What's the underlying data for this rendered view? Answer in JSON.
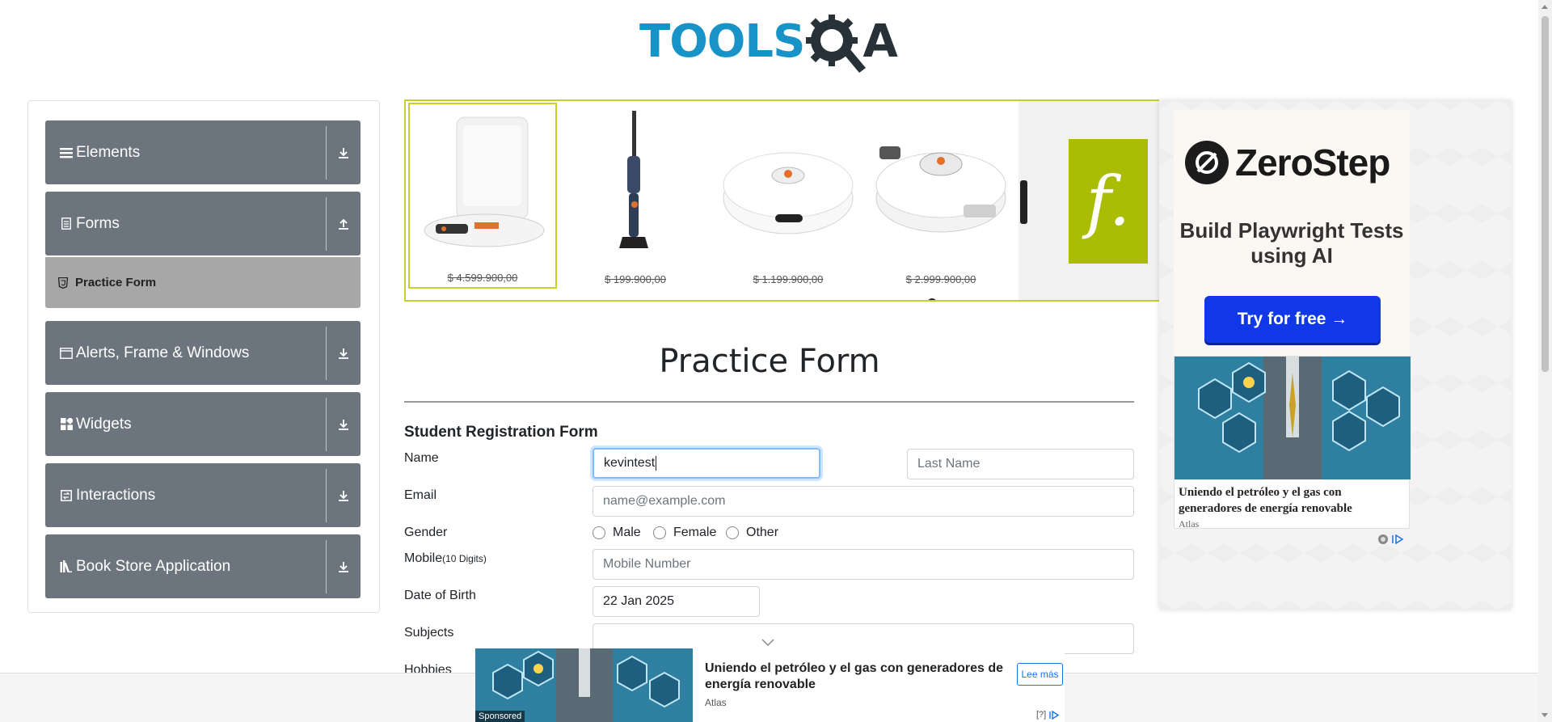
{
  "header": {
    "logo_text": "TOOLS",
    "logo_suffix": "A"
  },
  "sidebar": {
    "groups": [
      {
        "label": "Elements",
        "icon": "hamburger-icon",
        "state": "collapsed"
      },
      {
        "label": "Forms",
        "icon": "document-icon",
        "state": "expanded"
      },
      {
        "label": "Alerts, Frame & Windows",
        "icon": "window-icon",
        "state": "collapsed"
      },
      {
        "label": "Widgets",
        "icon": "widgets-icon",
        "state": "collapsed"
      },
      {
        "label": "Interactions",
        "icon": "interactions-icon",
        "state": "collapsed"
      },
      {
        "label": "Book Store Application",
        "icon": "books-icon",
        "state": "collapsed"
      }
    ],
    "active_item": {
      "label": "Practice Form",
      "icon": "html5-icon"
    }
  },
  "carousel_ad": {
    "products": [
      {
        "price": "$ 4.599.900,00",
        "image": "robot-vacuum-dock"
      },
      {
        "price": "$ 199.900,00",
        "image": "stick-vacuum"
      },
      {
        "price": "$ 1.199.900,00",
        "image": "robot-vacuum"
      },
      {
        "price": "$ 2.999.900,00",
        "image": "robot-vacuum-lidar"
      }
    ],
    "brand_glyph": "f.",
    "accent_color": "#c7cf2b",
    "brand_color": "#aabd04"
  },
  "form": {
    "page_title": "Practice Form",
    "subtitle": "Student Registration Form",
    "name_label": "Name",
    "first_name_value": "kevintest",
    "last_name_placeholder": "Last Name",
    "email_label": "Email",
    "email_placeholder": "name@example.com",
    "gender_label": "Gender",
    "gender_options": [
      "Male",
      "Female",
      "Other"
    ],
    "mobile_label": "Mobile",
    "mobile_hint": "(10 Digits)",
    "mobile_placeholder": "Mobile Number",
    "dob_label": "Date of Birth",
    "dob_value": "22 Jan 2025",
    "subjects_label": "Subjects",
    "hobbies_label": "Hobbies"
  },
  "right_ad": {
    "brand": "ZeroStep",
    "tagline": "Build Playwright Tests using AI",
    "cta": "Try for free →",
    "cta_color": "#1138e8",
    "article_title": "Uniendo el petróleo y el gas con generadores de energía renovable",
    "article_source": "Atlas"
  },
  "bottom_ad": {
    "title": "Uniendo el petróleo y el gas con generadores de energía renovable",
    "source": "Atlas",
    "sponsored": "Sponsored",
    "button": "Lee más",
    "choice": "[?]"
  }
}
